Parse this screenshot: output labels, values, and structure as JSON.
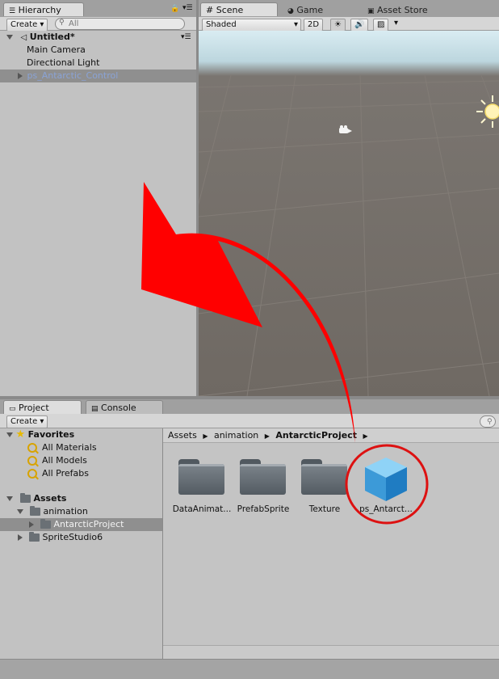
{
  "hierarchy": {
    "tab_label": "Hierarchy",
    "create_label": "Create",
    "search_placeholder": "All",
    "scene_name": "Untitled*",
    "items": [
      "Main Camera",
      "Directional Light",
      "ps_Antarctic_Control"
    ]
  },
  "scene_view": {
    "tabs": [
      "Scene",
      "Game",
      "Asset Store"
    ],
    "shading_mode": "Shaded",
    "mode_2d_label": "2D"
  },
  "project": {
    "tabs": [
      "Project",
      "Console"
    ],
    "create_label": "Create",
    "favorites_label": "Favorites",
    "favorites": [
      "All Materials",
      "All Models",
      "All Prefabs"
    ],
    "assets_label": "Assets",
    "tree": [
      "animation",
      "AntarcticProject",
      "SpriteStudio6"
    ],
    "breadcrumb": [
      "Assets",
      "animation",
      "AntarcticProject"
    ],
    "assets": [
      "DataAnimat...",
      "PrefabSprite",
      "Texture",
      "ps_Antarct..."
    ]
  },
  "colors": {
    "arrow": "#ff0000",
    "highlight_circle": "#dd1111",
    "selected_text": "#8aa3d6"
  }
}
